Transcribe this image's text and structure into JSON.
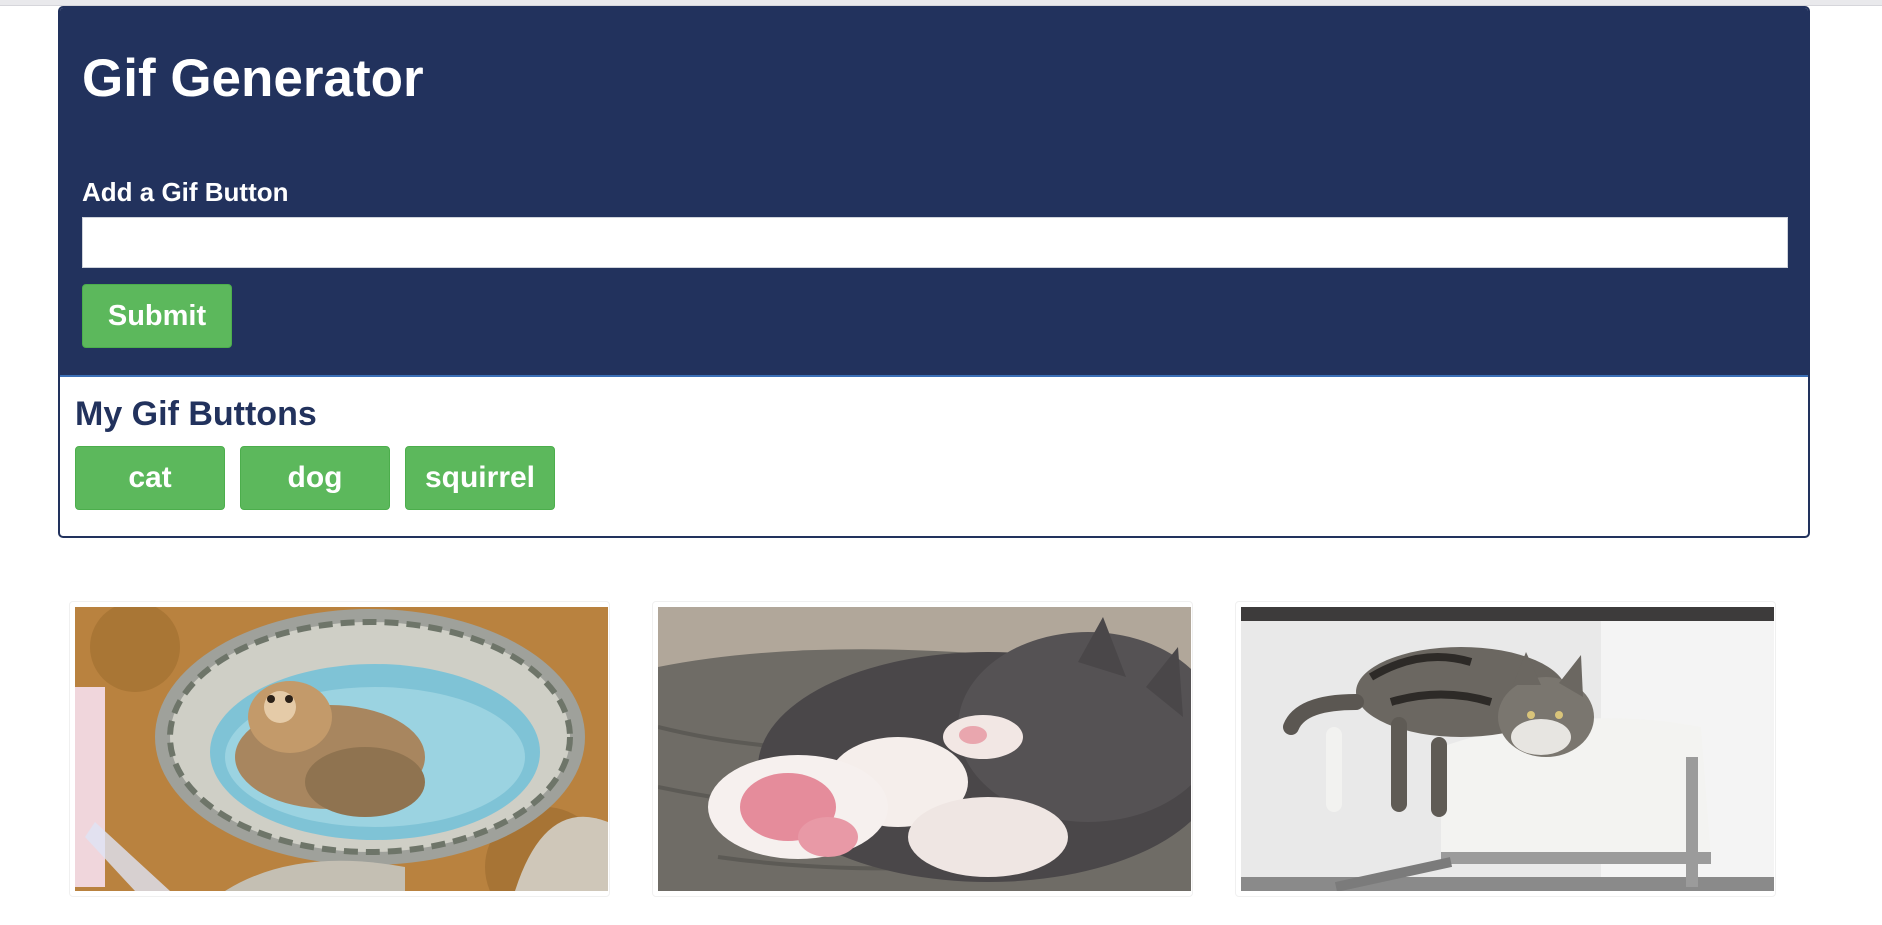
{
  "header": {
    "title": "Gif Generator"
  },
  "form": {
    "label": "Add a Gif Button",
    "input_value": "",
    "placeholder": "",
    "submit_label": "Submit"
  },
  "buttons_section": {
    "title": "My Gif Buttons",
    "buttons": [
      {
        "label": "cat"
      },
      {
        "label": "dog"
      },
      {
        "label": "squirrel"
      }
    ]
  },
  "gifs": [
    {
      "subject": "kitten lying in a woven basket"
    },
    {
      "subject": "grey and white kitten sleeping on its back"
    },
    {
      "subject": "tabby cat resting on a white sofa arm"
    }
  ],
  "colors": {
    "header_bg": "#22325d",
    "button_green": "#5cb85c",
    "heading_navy": "#22325d"
  }
}
